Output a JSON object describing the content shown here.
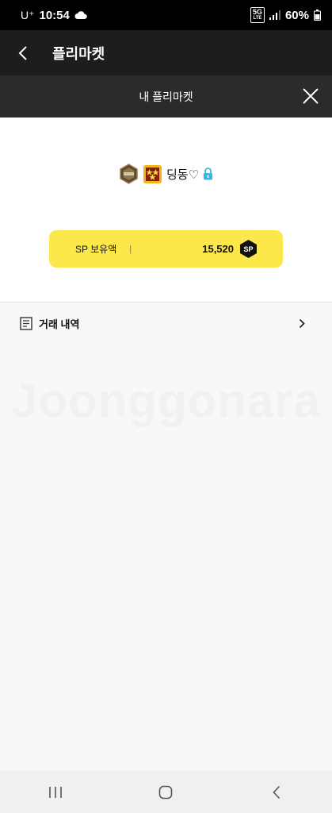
{
  "status_bar": {
    "carrier": "U⁺",
    "time": "10:54",
    "network": "5G",
    "network_sub": "LTE",
    "battery": "60%",
    "icons": [
      "cloud-icon",
      "signal-icon",
      "battery-icon"
    ]
  },
  "header": {
    "title": "플리마켓",
    "back_icon": "chevron-left-icon"
  },
  "sub_header": {
    "title": "내 플리마켓",
    "close_icon": "close-icon"
  },
  "profile": {
    "nickname": "딩동♡",
    "badges": [
      "vip-badge-icon",
      "grade-badge-icon"
    ],
    "lock_icon": "lock-icon"
  },
  "sp_card": {
    "label": "SP 보유액",
    "divider": "|",
    "value": "15,520",
    "badge": "SP"
  },
  "history": {
    "label": "거래 내역",
    "icon": "document-icon"
  },
  "watermark": "Joonggonara",
  "colors": {
    "accent_yellow": "#fde84c",
    "header_bg": "#1d1d1d",
    "sub_header_bg": "#2b2b2b"
  }
}
